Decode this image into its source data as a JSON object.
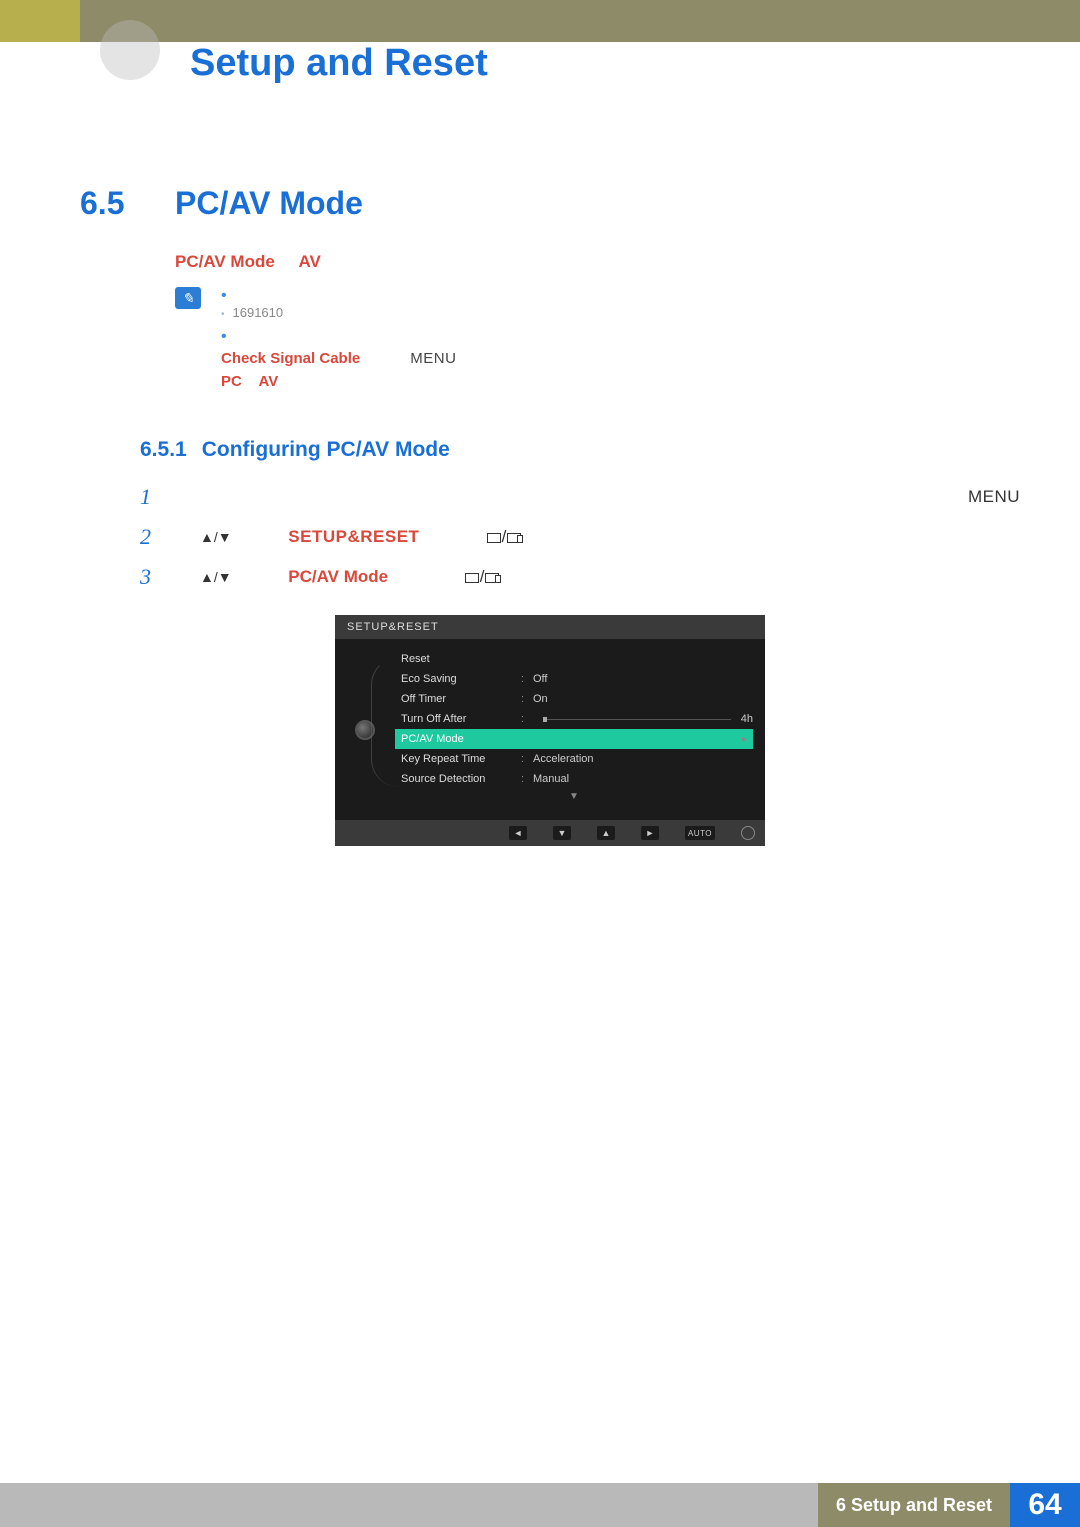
{
  "header": {
    "chapter_title": "Setup and Reset"
  },
  "section": {
    "number": "6.5",
    "title": "PC/AV Mode"
  },
  "intro": {
    "pcav": "PC/AV Mode",
    "av": "AV"
  },
  "notes": {
    "sub1": "1691610",
    "check_cable": "Check Signal Cable",
    "menu": "MENU",
    "pc": "PC",
    "av2": "AV"
  },
  "subsection": {
    "number": "6.5.1",
    "title": "Configuring PC/AV Mode"
  },
  "steps": {
    "s1": "1",
    "s1_menu": "MENU",
    "s2": "2",
    "s2_arrows": "▲/▼",
    "s2_target": "SETUP&RESET",
    "s3": "3",
    "s3_arrows": "▲/▼",
    "s3_target": "PC/AV Mode"
  },
  "osd": {
    "title": "SETUP&RESET",
    "rows": {
      "reset": "Reset",
      "eco": "Eco Saving",
      "eco_v": "Off",
      "ot": "Off Timer",
      "ot_v": "On",
      "toa": "Turn Off After",
      "toa_v": "4h",
      "pcav": "PC/AV Mode",
      "krt": "Key Repeat Time",
      "krt_v": "Acceleration",
      "sd": "Source Detection",
      "sd_v": "Manual"
    },
    "footer": {
      "auto": "AUTO"
    }
  },
  "footer": {
    "chapter": "6 Setup and Reset",
    "page": "64"
  }
}
